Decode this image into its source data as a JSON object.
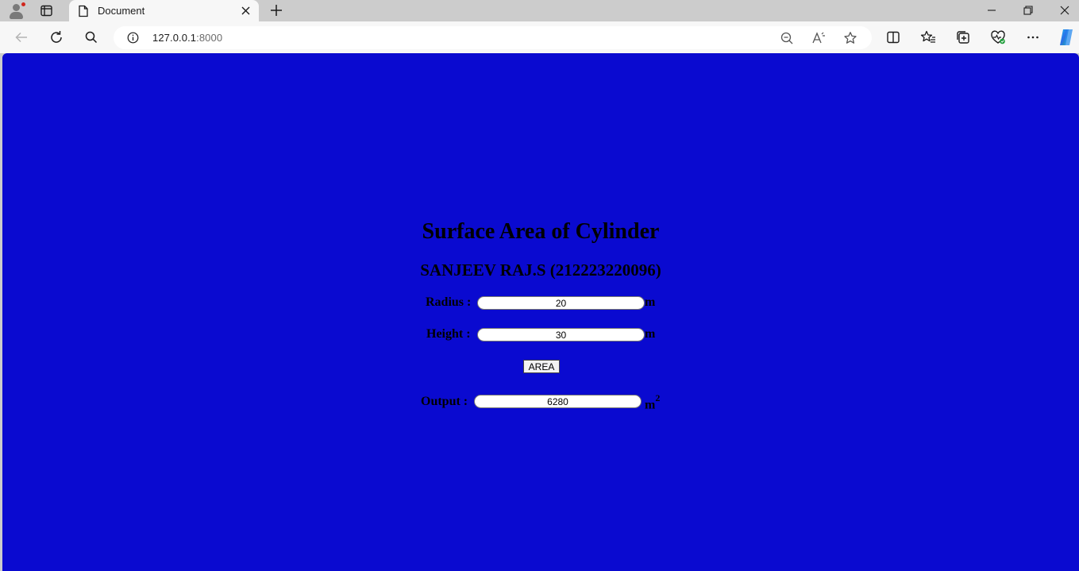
{
  "browser": {
    "tab_title": "Document",
    "url_host": "127.0.0.1",
    "url_port": ":8000"
  },
  "page": {
    "title": "Surface Area of Cylinder",
    "subtitle": "SANJEEV RAJ.S (212223220096)",
    "radius": {
      "label": "Radius :",
      "value": "20",
      "unit": "m"
    },
    "height": {
      "label": "Height :",
      "value": "30",
      "unit": "m"
    },
    "button_label": "AREA",
    "output": {
      "label": "Output :",
      "value": "6280",
      "unit": "m",
      "unit_sup": "2"
    },
    "background_color": "#0a0ad0"
  },
  "icons": {
    "tabstrip": [
      "profile-icon",
      "tab-actions-icon",
      "document-icon",
      "close-icon",
      "new-tab-icon",
      "minimize-icon",
      "restore-icon",
      "window-close-icon"
    ],
    "toolbar": [
      "back-icon",
      "refresh-icon",
      "search-icon",
      "info-icon",
      "zoom-out-icon",
      "read-aloud-icon",
      "favorite-star-icon",
      "split-screen-icon",
      "favorites-icon",
      "collections-icon",
      "browser-essentials-icon",
      "more-icon",
      "copilot-icon"
    ]
  }
}
